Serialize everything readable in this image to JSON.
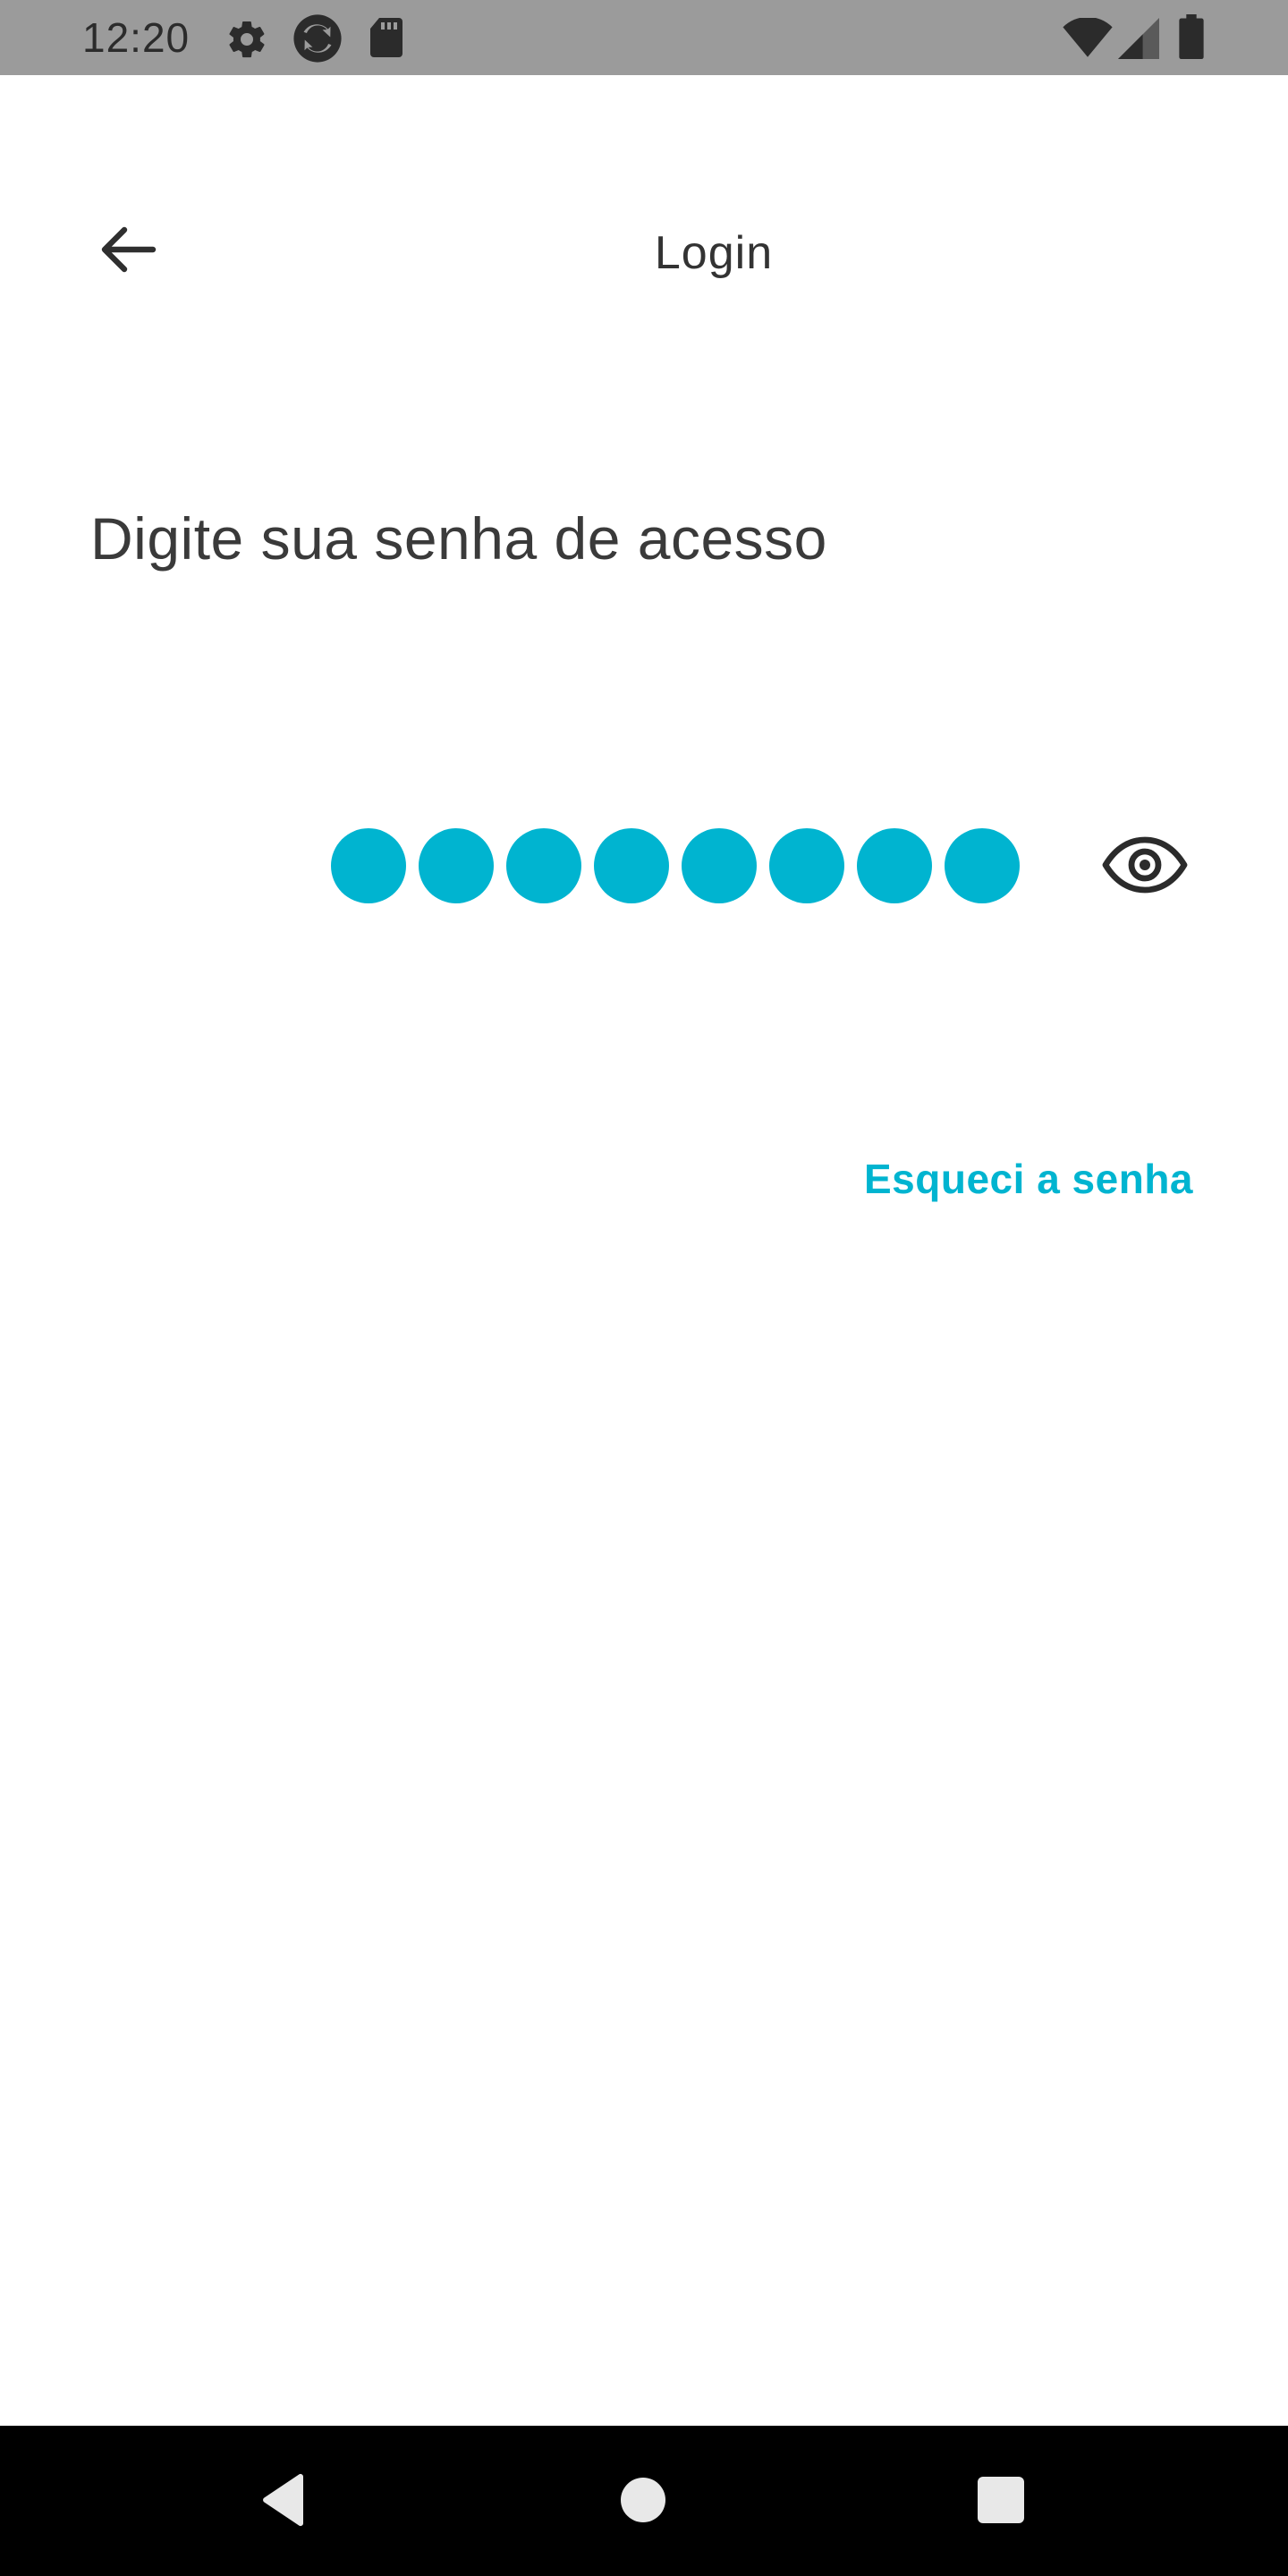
{
  "status_bar": {
    "time": "12:20",
    "icons_left": [
      "settings-icon",
      "sync-icon",
      "sd-card-icon"
    ],
    "icons_right": [
      "wifi-icon",
      "cell-signal-icon",
      "battery-icon"
    ]
  },
  "app_bar": {
    "back_icon": "arrow-left-icon",
    "title": "Login"
  },
  "main": {
    "heading": "Digite sua senha de acesso",
    "pin": {
      "length": 8,
      "dot_color": "#00b4d0"
    },
    "visibility_icon": "eye-icon",
    "forgot_password_label": "Esqueci a senha"
  },
  "nav_bar": {
    "buttons": [
      "back-triangle-icon",
      "home-circle-icon",
      "recents-square-icon"
    ]
  },
  "colors": {
    "accent": "#00b4d0",
    "status_bar": "#9b9b9b",
    "text": "#333333",
    "nav_bar": "#000000"
  }
}
